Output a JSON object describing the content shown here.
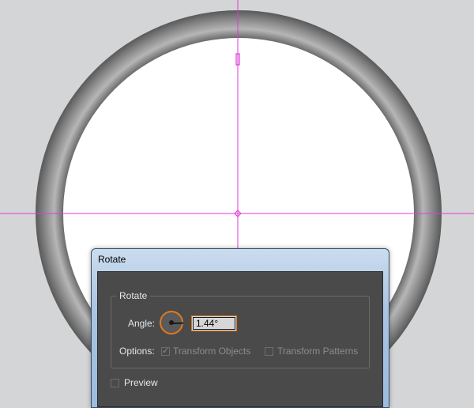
{
  "dialog": {
    "title": "Rotate",
    "group_title": "Rotate",
    "angle": {
      "label": "Angle:",
      "value": "1.44°",
      "degrees": 1.44
    },
    "options": {
      "label": "Options:",
      "transform_objects": {
        "label": "Transform Objects",
        "checked": true,
        "enabled": false
      },
      "transform_patterns": {
        "label": "Transform Patterns",
        "checked": false,
        "enabled": false
      }
    },
    "preview": {
      "label": "Preview",
      "checked": false
    }
  },
  "colors": {
    "canvas_background": "#d4d5d7",
    "guide_line": "#e03bd6",
    "ring_dark": "#5d5d5d",
    "ring_light": "#a9a9a9",
    "dialog_body": "#4a4a4a",
    "accent_orange": "#e07a1f"
  }
}
